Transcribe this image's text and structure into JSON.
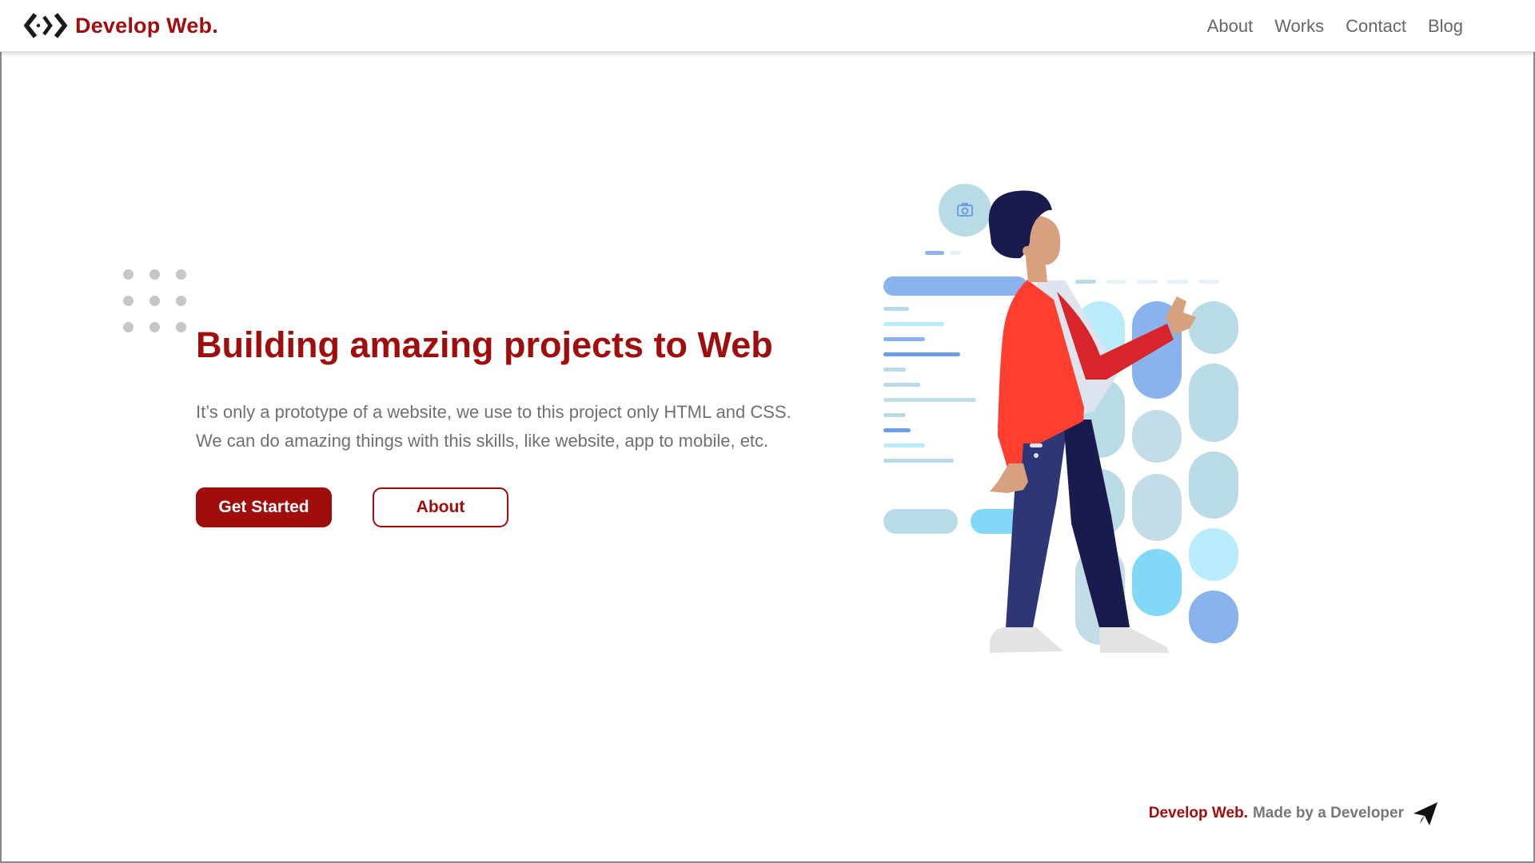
{
  "header": {
    "brand": "Develop Web.",
    "logo_icon": "code-brackets-icon",
    "nav": [
      "About",
      "Works",
      "Contact",
      "Blog"
    ]
  },
  "hero": {
    "title": "Building amazing projects to Web",
    "description": [
      "It’s only a prototype of a website, we use to this project only HTML and CSS.",
      "We can do amazing things with this skills, like website, app to mobile, etc."
    ],
    "primary_button": "Get Started",
    "secondary_button": "About",
    "illustration": "developer-with-ui-board-illustration"
  },
  "footer": {
    "brand": "Develop Web.",
    "text": "Made by a Developer",
    "icon": "paper-plane-icon"
  },
  "colors": {
    "accent": "#a00d0d",
    "nav_text": "#666666",
    "body_text": "#707070"
  }
}
